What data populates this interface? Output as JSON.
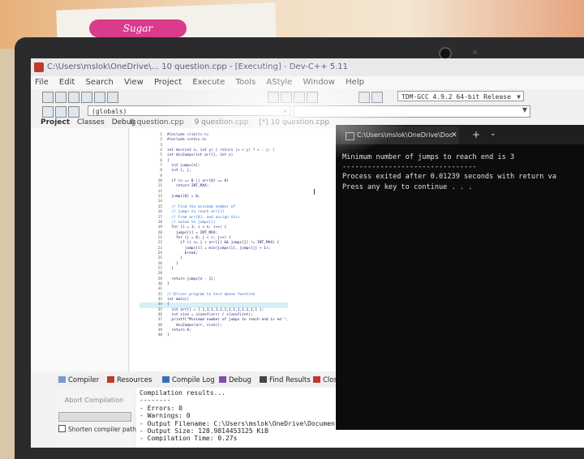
{
  "window": {
    "title": "C:\\Users\\mslok\\OneDrive\\... 10 question.cpp - [Executing] - Dev-C++ 5.11"
  },
  "menu": [
    "File",
    "Edit",
    "Search",
    "View",
    "Project",
    "Execute",
    "Tools",
    "AStyle",
    "Window",
    "Help"
  ],
  "toolbar": {
    "compiler": "TDM-GCC 4.9.2 64-bit Release",
    "globals": "(globals)"
  },
  "left_panel": {
    "tabs": [
      "Project",
      "Classes",
      "Debug"
    ]
  },
  "editor": {
    "tabs": [
      "8 question.cpp",
      "9 question.cpp",
      "[*] 10 question.cpp"
    ],
    "lines": [
      "#include <limits.h>",
      "#include <stdio.h>",
      "",
      "int min(int x, int y) { return (x < y) ? x : y; }",
      "int minJumps(int arr[], int n)",
      "{",
      "  int jumps[n];",
      "  int i, j;",
      "",
      "  if (n == 0 || arr[0] == 0)",
      "    return INT_MAX;",
      "",
      "  jumps[0] = 0;",
      "",
      "  // Find the minimum number of",
      "  // jumps to reach arr[i]",
      "  // from arr[0], and assign this",
      "  // value to jumps[i]",
      "  for (i = 1; i < n; i++) {",
      "    jumps[i] = INT_MAX;",
      "    for (j = 0; j < i; j++) {",
      "      if (i <= j + arr[j] && jumps[j] != INT_MAX) {",
      "        jumps[i] = min(jumps[i], jumps[j] + 1);",
      "        break;",
      "      }",
      "    }",
      "  }",
      "",
      "  return jumps[n - 1];",
      "}",
      "",
      "// Driver program to test above function",
      "int main()",
      "{",
      "  int arr[] = { 1,1,1,1,1,1,1,1,1,1,1,1,1 };",
      "  int size = sizeof(arr) / sizeof(int);",
      "  printf(\"Minimum number of jumps to reach end is %d \",",
      "    minJumps(arr, size));",
      "  return 0;",
      "}"
    ]
  },
  "bottom": {
    "tabs": [
      "Compiler",
      "Resources",
      "Compile Log",
      "Debug",
      "Find Results",
      "Close"
    ],
    "abort_label": "Abort Compilation",
    "shorten_label": "Shorten compiler paths",
    "log": [
      "Compilation results...",
      "--------",
      "- Errors: 0",
      "- Warnings: 0",
      "- Output Filename: C:\\Users\\mslok\\OneDrive\\Documen",
      "- Output Size: 128.9814453125 KiB",
      "- Compilation Time: 0.27s"
    ]
  },
  "console": {
    "tab_title": "C:\\Users\\mslok\\OneDrive\\Doc",
    "output": [
      "Minimum number of jumps to reach end is 3",
      "--------------------------------",
      "Process exited after 0.01239 seconds with return va",
      "Press any key to continue . . ."
    ]
  }
}
